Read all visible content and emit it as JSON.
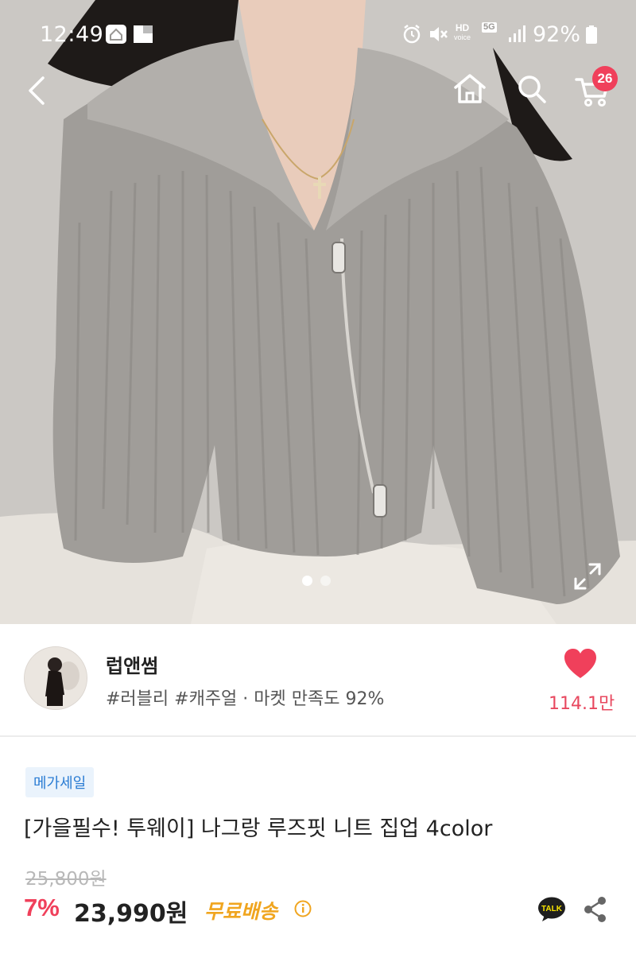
{
  "status_bar": {
    "time": "12:49",
    "battery": "92%",
    "icons": [
      "home-status-icon",
      "flipboard-icon",
      "alarm-icon",
      "mute-icon",
      "hd-voice-icon",
      "5g-icon",
      "signal-icon",
      "battery-icon"
    ],
    "hd_label": "HD",
    "voice_label": "voice",
    "network_label": "5G"
  },
  "nav": {
    "icons": [
      "back-icon",
      "home-icon",
      "search-icon",
      "cart-icon"
    ],
    "cart_count": "26"
  },
  "carousel": {
    "total": 2,
    "current": 1
  },
  "store": {
    "name": "럽앤썸",
    "tags": "#러블리 #캐주얼 · 마켓 만족도 92%",
    "likes": "114.1만"
  },
  "product": {
    "badge": "메가세일",
    "title": "[가을필수! 투웨이] 나그랑 루즈핏 니트 집업 4color",
    "original_price": "25,800원",
    "discount": "7%",
    "price": "23,990원",
    "shipping": "무료배송"
  },
  "actions": {
    "talk_label": "TALK"
  },
  "colors": {
    "accent": "#f0405b",
    "shipping": "#f0a51f",
    "badge_text": "#2a7cd3",
    "badge_bg": "#eaf3fc"
  }
}
